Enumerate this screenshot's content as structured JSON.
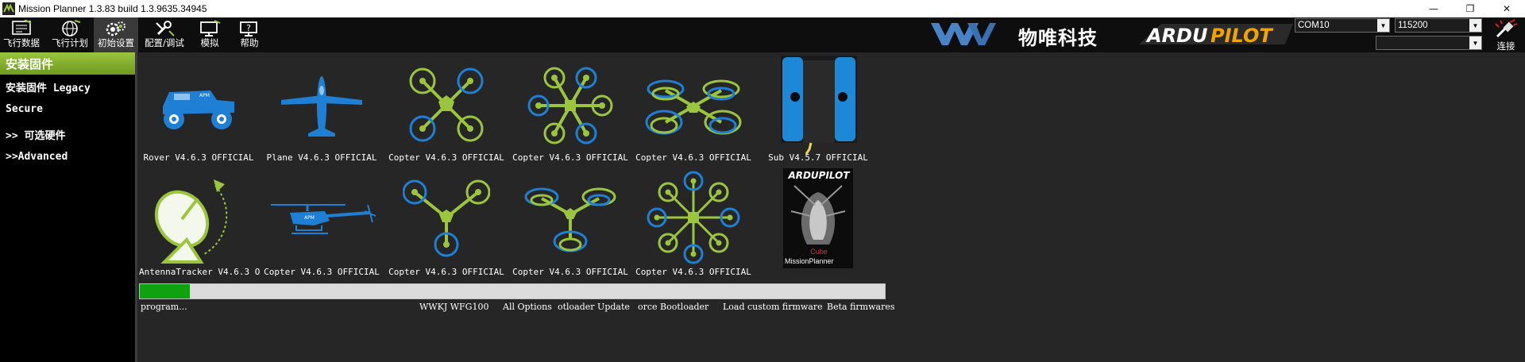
{
  "window": {
    "title": "Mission Planner 1.3.83 build 1.3.9635.34945",
    "controls": [
      "—",
      "❐",
      "✕"
    ]
  },
  "toolbar": {
    "items": [
      {
        "label": "飞行数据",
        "icon": "flight-data-icon"
      },
      {
        "label": "飞行计划",
        "icon": "flight-plan-icon"
      },
      {
        "label": "初始设置",
        "icon": "initial-setup-icon"
      },
      {
        "label": "配置/调试",
        "icon": "config-tuning-icon"
      },
      {
        "label": "模拟",
        "icon": "simulation-icon"
      },
      {
        "label": "帮助",
        "icon": "help-icon"
      }
    ],
    "brand_cn": "物唯科技",
    "brand_ardu": "ARDUPILOT",
    "port_value": "COM10",
    "baud_value": "115200",
    "extra_value": "",
    "connect_label": "连接"
  },
  "sidebar": {
    "items": [
      {
        "label": "安装固件"
      },
      {
        "label": "安装固件 Legacy"
      },
      {
        "label": "Secure"
      },
      {
        "label": ">> 可选硬件"
      },
      {
        "label": ">>Advanced"
      }
    ]
  },
  "firmware": {
    "row1": [
      {
        "label": "Rover V4.6.3 OFFICIAL"
      },
      {
        "label": "Plane V4.6.3 OFFICIAL"
      },
      {
        "label": "Copter V4.6.3 OFFICIAL"
      },
      {
        "label": "Copter V4.6.3 OFFICIAL"
      },
      {
        "label": "Copter V4.6.3 OFFICIAL"
      },
      {
        "label": "Sub V4.5.7 OFFICIAL"
      }
    ],
    "row2": [
      {
        "label": "AntennaTracker  V4.6.3 O"
      },
      {
        "label": "Copter V4.6.3 OFFICIAL"
      },
      {
        "label": "Copter V4.6.3 OFFICIAL"
      },
      {
        "label": "Copter V4.6.3 OFFICIAL"
      },
      {
        "label": "Copter V4.6.3 OFFICIAL"
      },
      {
        "label": ""
      }
    ],
    "cube_logo_text": "ARDUPILOT",
    "cube_label": "Cube",
    "cube_mp": "MissionPlanner",
    "apm_text": "APM"
  },
  "progress": {
    "fraction": 0.067
  },
  "status": {
    "program": "program...",
    "wwkj": "WWKJ WFG100",
    "all_options": "All Options",
    "bootloader_update": "otloader Update",
    "force_bootloader": "orce Bootloader",
    "load_custom": "Load custom firmware",
    "beta": "Beta firmwares"
  },
  "colors": {
    "accent_green": "#9bc53d",
    "blue": "#1e7fd4",
    "progress": "#0fa10f"
  }
}
